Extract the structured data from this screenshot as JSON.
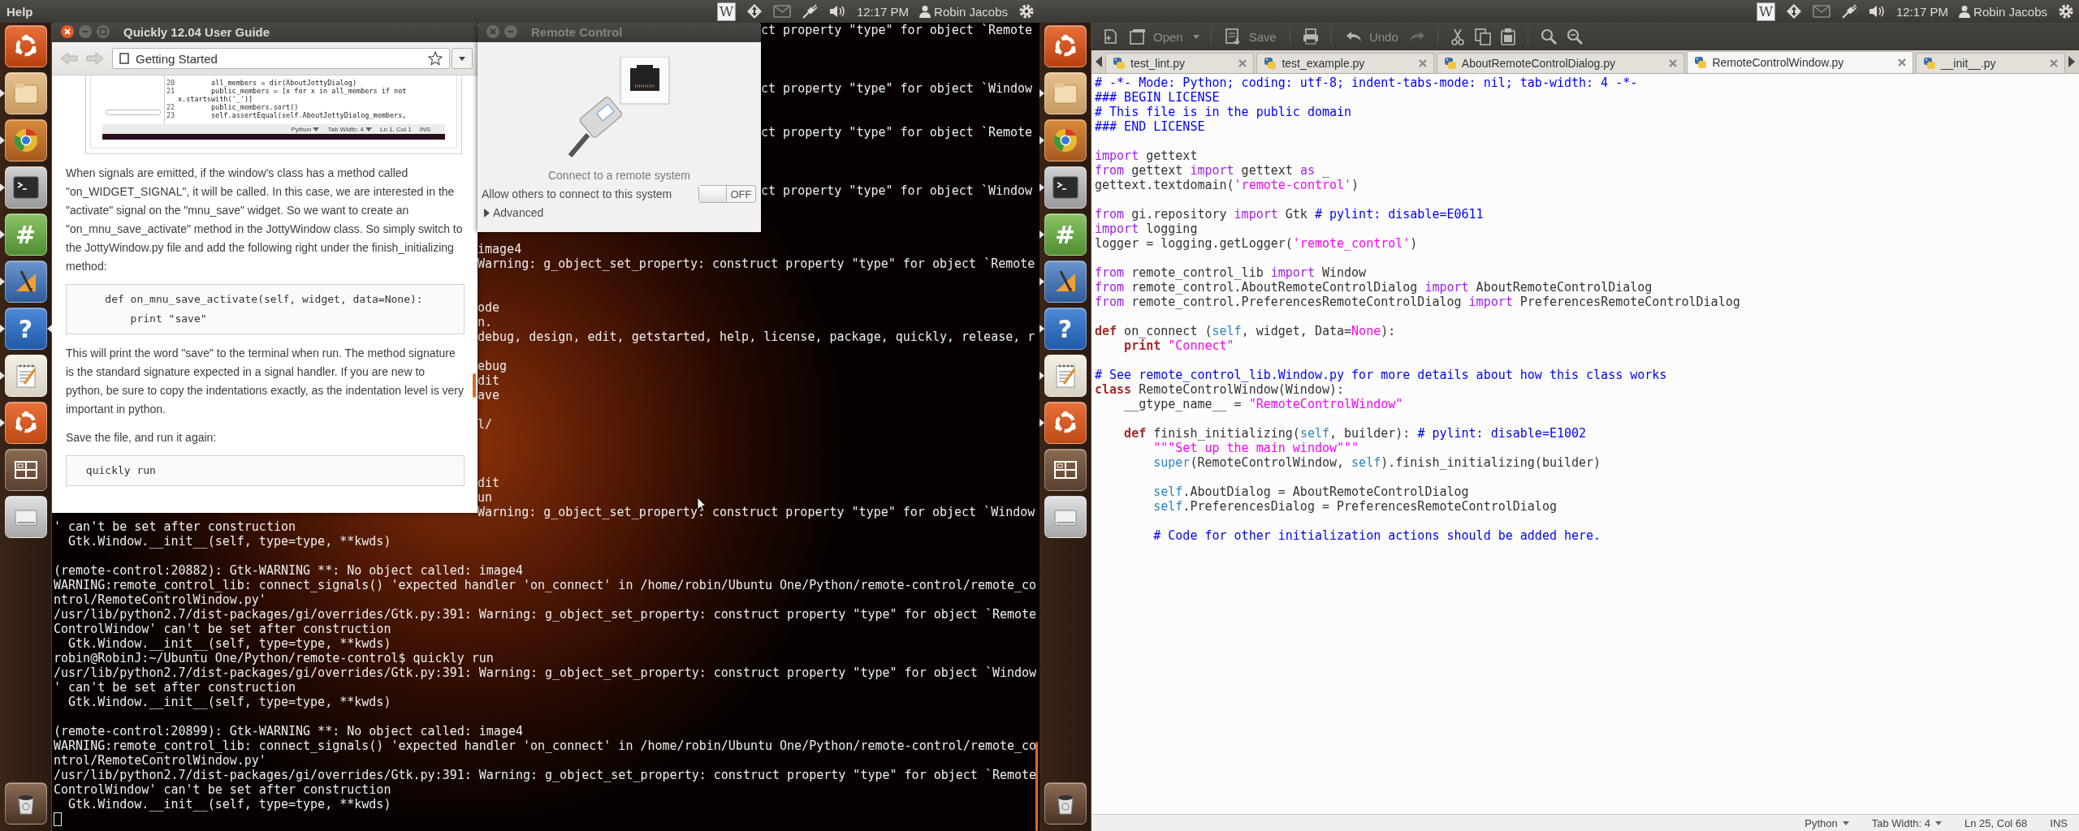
{
  "left_screen": {
    "top_panel": {
      "app_menu": "Help",
      "indicators": {
        "app_letter": "W",
        "time": "12:17 PM",
        "user": "Robin Jacobs"
      }
    },
    "launcher": [
      {
        "kind": "dash",
        "running": false,
        "focused": false
      },
      {
        "kind": "folder",
        "running": true,
        "focused": false
      },
      {
        "kind": "browser",
        "running": true,
        "focused": false
      },
      {
        "kind": "terminal",
        "running": true,
        "focused": false
      },
      {
        "kind": "hashtag",
        "glyph": "#",
        "running": true,
        "focused": false
      },
      {
        "kind": "drawing",
        "running": true,
        "focused": false
      },
      {
        "kind": "help",
        "glyph": "?",
        "running": true,
        "focused": true
      },
      {
        "kind": "notepad",
        "running": true,
        "focused": false
      },
      {
        "kind": "ubuntu_one",
        "running": true,
        "focused": false
      },
      {
        "kind": "workspaces",
        "running": false,
        "focused": false
      },
      {
        "kind": "drive",
        "running": false,
        "focused": false
      },
      {
        "kind": "trash",
        "running": false,
        "focused": false
      }
    ],
    "terminal": {
      "rows": [
        {
          "kind": "behind_remote",
          "text": "ct property \"type\" for object `Remote"
        },
        {
          "kind": "empty"
        },
        {
          "kind": "empty"
        },
        {
          "kind": "empty"
        },
        {
          "kind": "behind_remote",
          "text": "ct property \"type\" for object `Window"
        },
        {
          "kind": "empty"
        },
        {
          "kind": "empty"
        },
        {
          "kind": "behind_remote",
          "text": "ct property \"type\" for object `Remote"
        },
        {
          "kind": "empty"
        },
        {
          "kind": "empty"
        },
        {
          "kind": "empty"
        },
        {
          "kind": "behind_remote",
          "text": "ct property \"type\" for object `Window"
        },
        {
          "kind": "empty"
        },
        {
          "kind": "empty"
        },
        {
          "kind": "empty"
        },
        {
          "kind": "behind_help",
          "text": "image4"
        },
        {
          "kind": "behind_help",
          "text": "Warning: g_object_set_property: construct property \"type\" for object `Remote"
        },
        {
          "kind": "empty"
        },
        {
          "kind": "empty"
        },
        {
          "kind": "behind_help",
          "text": "ode"
        },
        {
          "kind": "behind_help",
          "text": "n."
        },
        {
          "kind": "behind_help",
          "text": "debug, design, edit, getstarted, help, license, package, quickly, release, r"
        },
        {
          "kind": "empty"
        },
        {
          "kind": "behind_help",
          "text": "ebug"
        },
        {
          "kind": "behind_help",
          "text": "dit"
        },
        {
          "kind": "behind_help",
          "text": "ave"
        },
        {
          "kind": "empty"
        },
        {
          "kind": "behind_help",
          "text": "l/"
        },
        {
          "kind": "empty"
        },
        {
          "kind": "empty"
        },
        {
          "kind": "empty"
        },
        {
          "kind": "behind_help",
          "text": "dit"
        },
        {
          "kind": "behind_help",
          "text": "un"
        },
        {
          "kind": "behind_help",
          "text": "Warning: g_object_set_property: construct property \"type\" for object `Window"
        },
        {
          "kind": "full",
          "text": "' can't be set after construction"
        },
        {
          "kind": "full",
          "text": "  Gtk.Window.__init__(self, type=type, **kwds)"
        },
        {
          "kind": "empty"
        },
        {
          "kind": "full",
          "text": "(remote-control:20882): Gtk-WARNING **: No object called: image4"
        },
        {
          "kind": "full",
          "text": "WARNING:remote_control_lib: connect_signals() 'expected handler 'on_connect' in /home/robin/Ubuntu One/Python/remote-control/remote_co"
        },
        {
          "kind": "full",
          "text": "ntrol/RemoteControlWindow.py'"
        },
        {
          "kind": "full",
          "text": "/usr/lib/python2.7/dist-packages/gi/overrides/Gtk.py:391: Warning: g_object_set_property: construct property \"type\" for object `Remote"
        },
        {
          "kind": "full",
          "text": "ControlWindow' can't be set after construction"
        },
        {
          "kind": "full",
          "text": "  Gtk.Window.__init__(self, type=type, **kwds)"
        },
        {
          "kind": "full",
          "text": "robin@RobinJ:~/Ubuntu One/Python/remote-control$ quickly run"
        },
        {
          "kind": "full",
          "text": "/usr/lib/python2.7/dist-packages/gi/overrides/Gtk.py:391: Warning: g_object_set_property: construct property \"type\" for object `Window"
        },
        {
          "kind": "full",
          "text": "' can't be set after construction"
        },
        {
          "kind": "full",
          "text": "  Gtk.Window.__init__(self, type=type, **kwds)"
        },
        {
          "kind": "empty"
        },
        {
          "kind": "full",
          "text": "(remote-control:20899): Gtk-WARNING **: No object called: image4"
        },
        {
          "kind": "full",
          "text": "WARNING:remote_control_lib: connect_signals() 'expected handler 'on_connect' in /home/robin/Ubuntu One/Python/remote-control/remote_co"
        },
        {
          "kind": "full",
          "text": "ntrol/RemoteControlWindow.py'"
        },
        {
          "kind": "full",
          "text": "/usr/lib/python2.7/dist-packages/gi/overrides/Gtk.py:391: Warning: g_object_set_property: construct property \"type\" for object `Remote"
        },
        {
          "kind": "full",
          "text": "ControlWindow' can't be set after construction"
        },
        {
          "kind": "full",
          "text": "  Gtk.Window.__init__(self, type=type, **kwds)"
        },
        {
          "kind": "cursor"
        }
      ]
    },
    "help_window": {
      "title": "Quickly 12.04 User Guide",
      "location": "Getting Started",
      "figure": {
        "lines": [
          {
            "number": "20",
            "text": "        all_members = dir(AboutJottyDialog)"
          },
          {
            "number": "21",
            "text": "        public_members = [x for x in all_members if not"
          },
          {
            "text": "x.startswith('_')]"
          },
          {
            "number": "22",
            "text": "        public_members.sort()"
          },
          {
            "number": "23",
            "text": "        self.assertEqual(self.AboutJottyDialog_members,"
          }
        ],
        "status": {
          "language": "Python",
          "tab_width": "Tab Width: 4",
          "position": "Ln 1, Col 1",
          "mode": "INS"
        }
      },
      "content": [
        {
          "kind": "paragraph",
          "text": "When signals are emitted, if the window's class has a method called \"on_WIDGET_SIGNAL\", it will be called. In this case, we are interested in the \"activate\" signal on the \"mnu_save\" widget. So we want to create an \"on_mnu_save_activate\" method in the JottyWindow class. So simply switch to the JottyWindow.py file and add the following right under the finish_initializing method:"
        },
        {
          "kind": "code",
          "lines": [
            "    def on_mnu_save_activate(self, widget, data=None):",
            "        print \"save\""
          ]
        },
        {
          "kind": "paragraph",
          "text": "This will print the word \"save\" to the terminal when run. The method signature is the standard signature expected in a signal handler. If you are new to python, be sure to copy the indentations exactly, as the indentation level is very important in python."
        },
        {
          "kind": "paragraph",
          "text": "Save the file, and run it again:"
        },
        {
          "kind": "code",
          "lines": [
            " quickly run"
          ]
        }
      ]
    },
    "remote_control_window": {
      "title": "Remote Control",
      "caption": "Connect to a remote system",
      "switch": {
        "label": "Allow others to connect to this system",
        "state_text": "OFF",
        "on": false
      },
      "advanced": {
        "label": "Advanced",
        "expanded": false
      }
    }
  },
  "right_screen": {
    "top_panel": {
      "indicators": {
        "app_letter": "W",
        "time": "12:17 PM",
        "user": "Robin Jacobs"
      }
    },
    "launcher": [
      {
        "kind": "dash",
        "running": false,
        "focused": false
      },
      {
        "kind": "folder",
        "running": true,
        "focused": false
      },
      {
        "kind": "browser",
        "running": true,
        "focused": false
      },
      {
        "kind": "terminal",
        "running": true,
        "focused": false
      },
      {
        "kind": "hashtag",
        "glyph": "#",
        "running": true,
        "focused": false
      },
      {
        "kind": "drawing",
        "running": true,
        "focused": false
      },
      {
        "kind": "help",
        "glyph": "?",
        "running": true,
        "focused": false
      },
      {
        "kind": "notepad",
        "running": true,
        "focused": false
      },
      {
        "kind": "ubuntu_one",
        "running": true,
        "focused": false
      },
      {
        "kind": "workspaces",
        "running": false,
        "focused": false
      },
      {
        "kind": "drive",
        "running": false,
        "focused": false
      },
      {
        "kind": "trash",
        "running": false,
        "focused": false
      }
    ],
    "editor": {
      "toolbar": {
        "open": "Open",
        "save": "Save",
        "undo": "Undo"
      },
      "tabs": [
        {
          "label": "test_lint.py",
          "selected": false
        },
        {
          "label": "test_example.py",
          "selected": false
        },
        {
          "label": "AboutRemoteControlDialog.py",
          "selected": false
        },
        {
          "label": "RemoteControlWindow.py",
          "selected": true
        },
        {
          "label": "__init__.py",
          "selected": false
        }
      ],
      "lines": [
        {
          "kind": "code",
          "tokens": [
            {
              "text": "# -*- Mode: Python; coding: utf-8; indent-tabs-mode: nil; tab-width: 4 -*-",
              "kind": "comment"
            }
          ]
        },
        {
          "kind": "code",
          "tokens": [
            {
              "text": "### BEGIN LICENSE",
              "kind": "comment"
            }
          ]
        },
        {
          "kind": "code",
          "tokens": [
            {
              "text": "# This file is in the public domain",
              "kind": "comment"
            }
          ]
        },
        {
          "kind": "code",
          "tokens": [
            {
              "text": "### END LICENSE",
              "kind": "comment"
            }
          ]
        },
        {
          "kind": "blank"
        },
        {
          "kind": "code",
          "tokens": [
            {
              "text": "import",
              "kind": "keyword"
            },
            {
              "text": " gettext",
              "kind": "plain"
            }
          ]
        },
        {
          "kind": "code",
          "tokens": [
            {
              "text": "from",
              "kind": "keyword"
            },
            {
              "text": " gettext ",
              "kind": "plain"
            },
            {
              "text": "import",
              "kind": "keyword"
            },
            {
              "text": " gettext ",
              "kind": "plain"
            },
            {
              "text": "as",
              "kind": "keyword"
            },
            {
              "text": " _",
              "kind": "plain"
            }
          ]
        },
        {
          "kind": "code",
          "tokens": [
            {
              "text": "gettext.textdomain(",
              "kind": "plain"
            },
            {
              "text": "'remote-control'",
              "kind": "string"
            },
            {
              "text": ")",
              "kind": "plain"
            }
          ]
        },
        {
          "kind": "blank"
        },
        {
          "kind": "code",
          "tokens": [
            {
              "text": "from",
              "kind": "keyword"
            },
            {
              "text": " gi.repository ",
              "kind": "plain"
            },
            {
              "text": "import",
              "kind": "keyword"
            },
            {
              "text": " Gtk ",
              "kind": "plain"
            },
            {
              "text": "# pylint: disable=E0611",
              "kind": "comment"
            }
          ]
        },
        {
          "kind": "code",
          "tokens": [
            {
              "text": "import",
              "kind": "keyword"
            },
            {
              "text": " logging",
              "kind": "plain"
            }
          ]
        },
        {
          "kind": "code",
          "tokens": [
            {
              "text": "logger = logging.getLogger(",
              "kind": "plain"
            },
            {
              "text": "'remote_control'",
              "kind": "string"
            },
            {
              "text": ")",
              "kind": "plain"
            }
          ]
        },
        {
          "kind": "blank"
        },
        {
          "kind": "code",
          "tokens": [
            {
              "text": "from",
              "kind": "keyword"
            },
            {
              "text": " remote_control_lib ",
              "kind": "plain"
            },
            {
              "text": "import",
              "kind": "keyword"
            },
            {
              "text": " Window",
              "kind": "plain"
            }
          ]
        },
        {
          "kind": "code",
          "tokens": [
            {
              "text": "from",
              "kind": "keyword"
            },
            {
              "text": " remote_control.AboutRemoteControlDialog ",
              "kind": "plain"
            },
            {
              "text": "import",
              "kind": "keyword"
            },
            {
              "text": " AboutRemoteControlDialog",
              "kind": "plain"
            }
          ]
        },
        {
          "kind": "code",
          "tokens": [
            {
              "text": "from",
              "kind": "keyword"
            },
            {
              "text": " remote_control.PreferencesRemoteControlDialog ",
              "kind": "plain"
            },
            {
              "text": "import",
              "kind": "keyword"
            },
            {
              "text": " PreferencesRemoteControlDialog",
              "kind": "plain"
            }
          ]
        },
        {
          "kind": "blank"
        },
        {
          "kind": "code",
          "tokens": [
            {
              "text": "def",
              "kind": "statement"
            },
            {
              "text": " on_connect (",
              "kind": "plain"
            },
            {
              "text": "self",
              "kind": "builtin"
            },
            {
              "text": ", widget, Data=",
              "kind": "plain"
            },
            {
              "text": "None",
              "kind": "constant"
            },
            {
              "text": "):",
              "kind": "plain"
            }
          ]
        },
        {
          "kind": "code",
          "tokens": [
            {
              "text": "    print",
              "kind": "statement"
            },
            {
              "text": " \"Connect\"",
              "kind": "string"
            }
          ]
        },
        {
          "kind": "blank"
        },
        {
          "kind": "code",
          "tokens": [
            {
              "text": "# See remote_control_lib.Window.py for more details about how this class works",
              "kind": "comment"
            }
          ]
        },
        {
          "kind": "code",
          "tokens": [
            {
              "text": "class",
              "kind": "statement"
            },
            {
              "text": " RemoteControlWindow(Window):",
              "kind": "plain"
            }
          ]
        },
        {
          "kind": "code",
          "tokens": [
            {
              "text": "    __gtype_name__ = ",
              "kind": "plain"
            },
            {
              "text": "\"RemoteControlWindow\"",
              "kind": "string"
            }
          ]
        },
        {
          "kind": "blank"
        },
        {
          "kind": "code",
          "tokens": [
            {
              "text": "    def",
              "kind": "statement"
            },
            {
              "text": " finish_initializing(",
              "kind": "plain"
            },
            {
              "text": "self",
              "kind": "builtin"
            },
            {
              "text": ", builder): ",
              "kind": "plain"
            },
            {
              "text": "# pylint: disable=E1002",
              "kind": "comment"
            }
          ]
        },
        {
          "kind": "code",
          "tokens": [
            {
              "text": "        \"\"\"Set up the main window\"\"\"",
              "kind": "string"
            }
          ]
        },
        {
          "kind": "code",
          "tokens": [
            {
              "text": "        super",
              "kind": "builtin"
            },
            {
              "text": "(RemoteControlWindow, ",
              "kind": "plain"
            },
            {
              "text": "self",
              "kind": "builtin"
            },
            {
              "text": ").finish_initializing(builder)",
              "kind": "plain"
            }
          ]
        },
        {
          "kind": "blank"
        },
        {
          "kind": "code",
          "tokens": [
            {
              "text": "        self",
              "kind": "builtin"
            },
            {
              "text": ".AboutDialog = AboutRemoteControlDialog",
              "kind": "plain"
            }
          ]
        },
        {
          "kind": "code",
          "tokens": [
            {
              "text": "        self",
              "kind": "builtin"
            },
            {
              "text": ".PreferencesDialog = PreferencesRemoteControlDialog",
              "kind": "plain"
            }
          ]
        },
        {
          "kind": "blank"
        },
        {
          "kind": "code",
          "tokens": [
            {
              "text": "        # Code for other initialization actions should be added here.",
              "kind": "comment"
            }
          ]
        }
      ],
      "status_bar": {
        "language": "Python",
        "tab_width": "Tab Width: 4",
        "position": "Ln 25, Col 68",
        "mode": "INS"
      }
    }
  }
}
